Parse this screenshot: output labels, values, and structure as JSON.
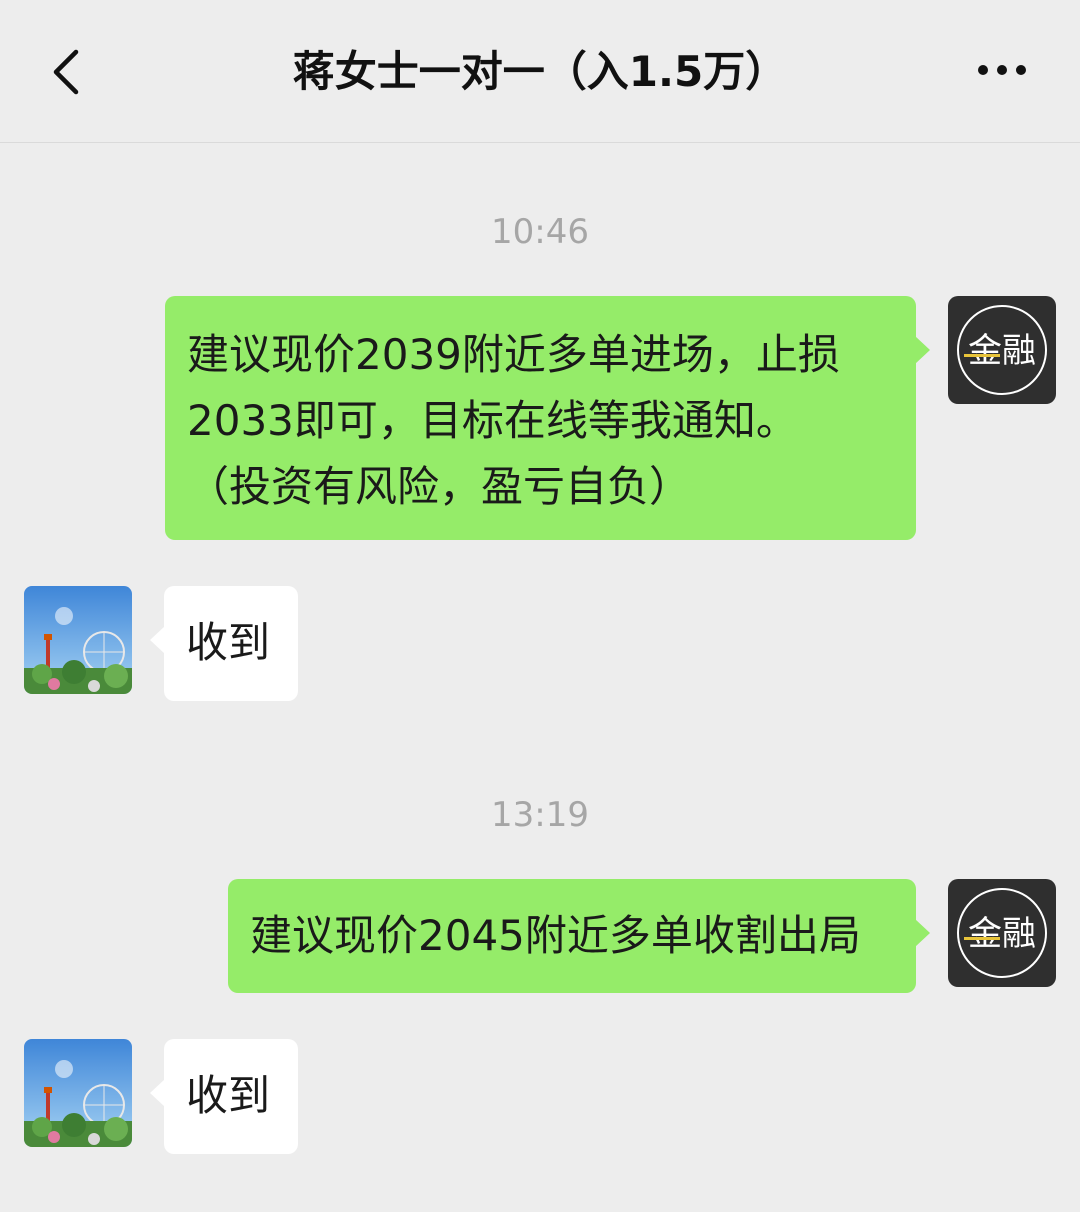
{
  "header": {
    "title": "蒋女士一对一（入1.5万）",
    "back_icon": "chevron-left-icon",
    "more_icon": "more-dots-icon"
  },
  "contact_avatar": {
    "text": "金融"
  },
  "messages": [
    {
      "time": "10:46",
      "sender": "me",
      "lines": [
        "建议现价2039附近多单进场，止损",
        "2033即可，目标在线等我通知。",
        "（投资有风险，盈亏自负）"
      ]
    },
    {
      "sender": "other",
      "lines": [
        "收到"
      ]
    },
    {
      "time": "13:19",
      "sender": "me",
      "lines": [
        "建议现价2045附近多单收割出局"
      ]
    },
    {
      "sender": "other",
      "lines": [
        "收到"
      ]
    }
  ],
  "colors": {
    "background": "#EDEDED",
    "outgoing_bubble": "#95EC69",
    "incoming_bubble": "#FFFFFF",
    "timestamp": "#A6A6A6"
  }
}
